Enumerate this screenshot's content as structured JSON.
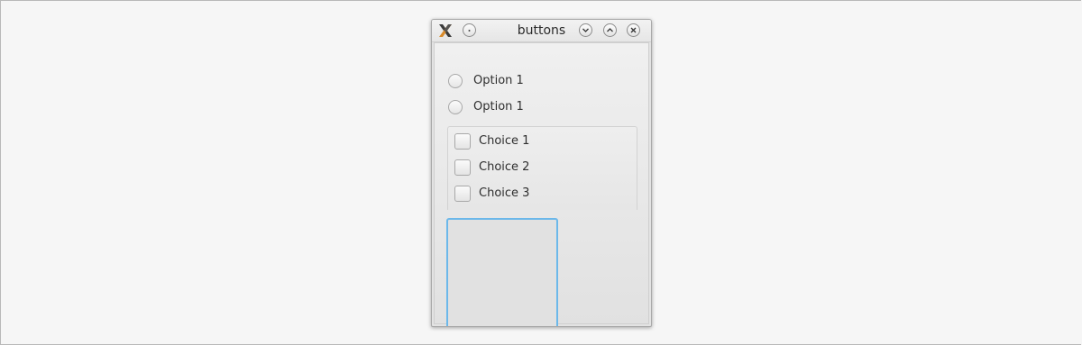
{
  "window": {
    "title": "buttons",
    "icon": "x-window-icon",
    "buttons": [
      "menu-dot-icon",
      "minimize-icon",
      "maximize-icon",
      "close-icon"
    ]
  },
  "radios": [
    {
      "label": "Option 1",
      "checked": false
    },
    {
      "label": "Option 1",
      "checked": false
    }
  ],
  "checkboxes": [
    {
      "label": "Choice 1",
      "checked": false
    },
    {
      "label": "Choice 2",
      "checked": false
    },
    {
      "label": "Choice 3",
      "checked": false
    }
  ],
  "colors": {
    "focus": "#6cb8ea",
    "background": "#f6f6f6"
  }
}
